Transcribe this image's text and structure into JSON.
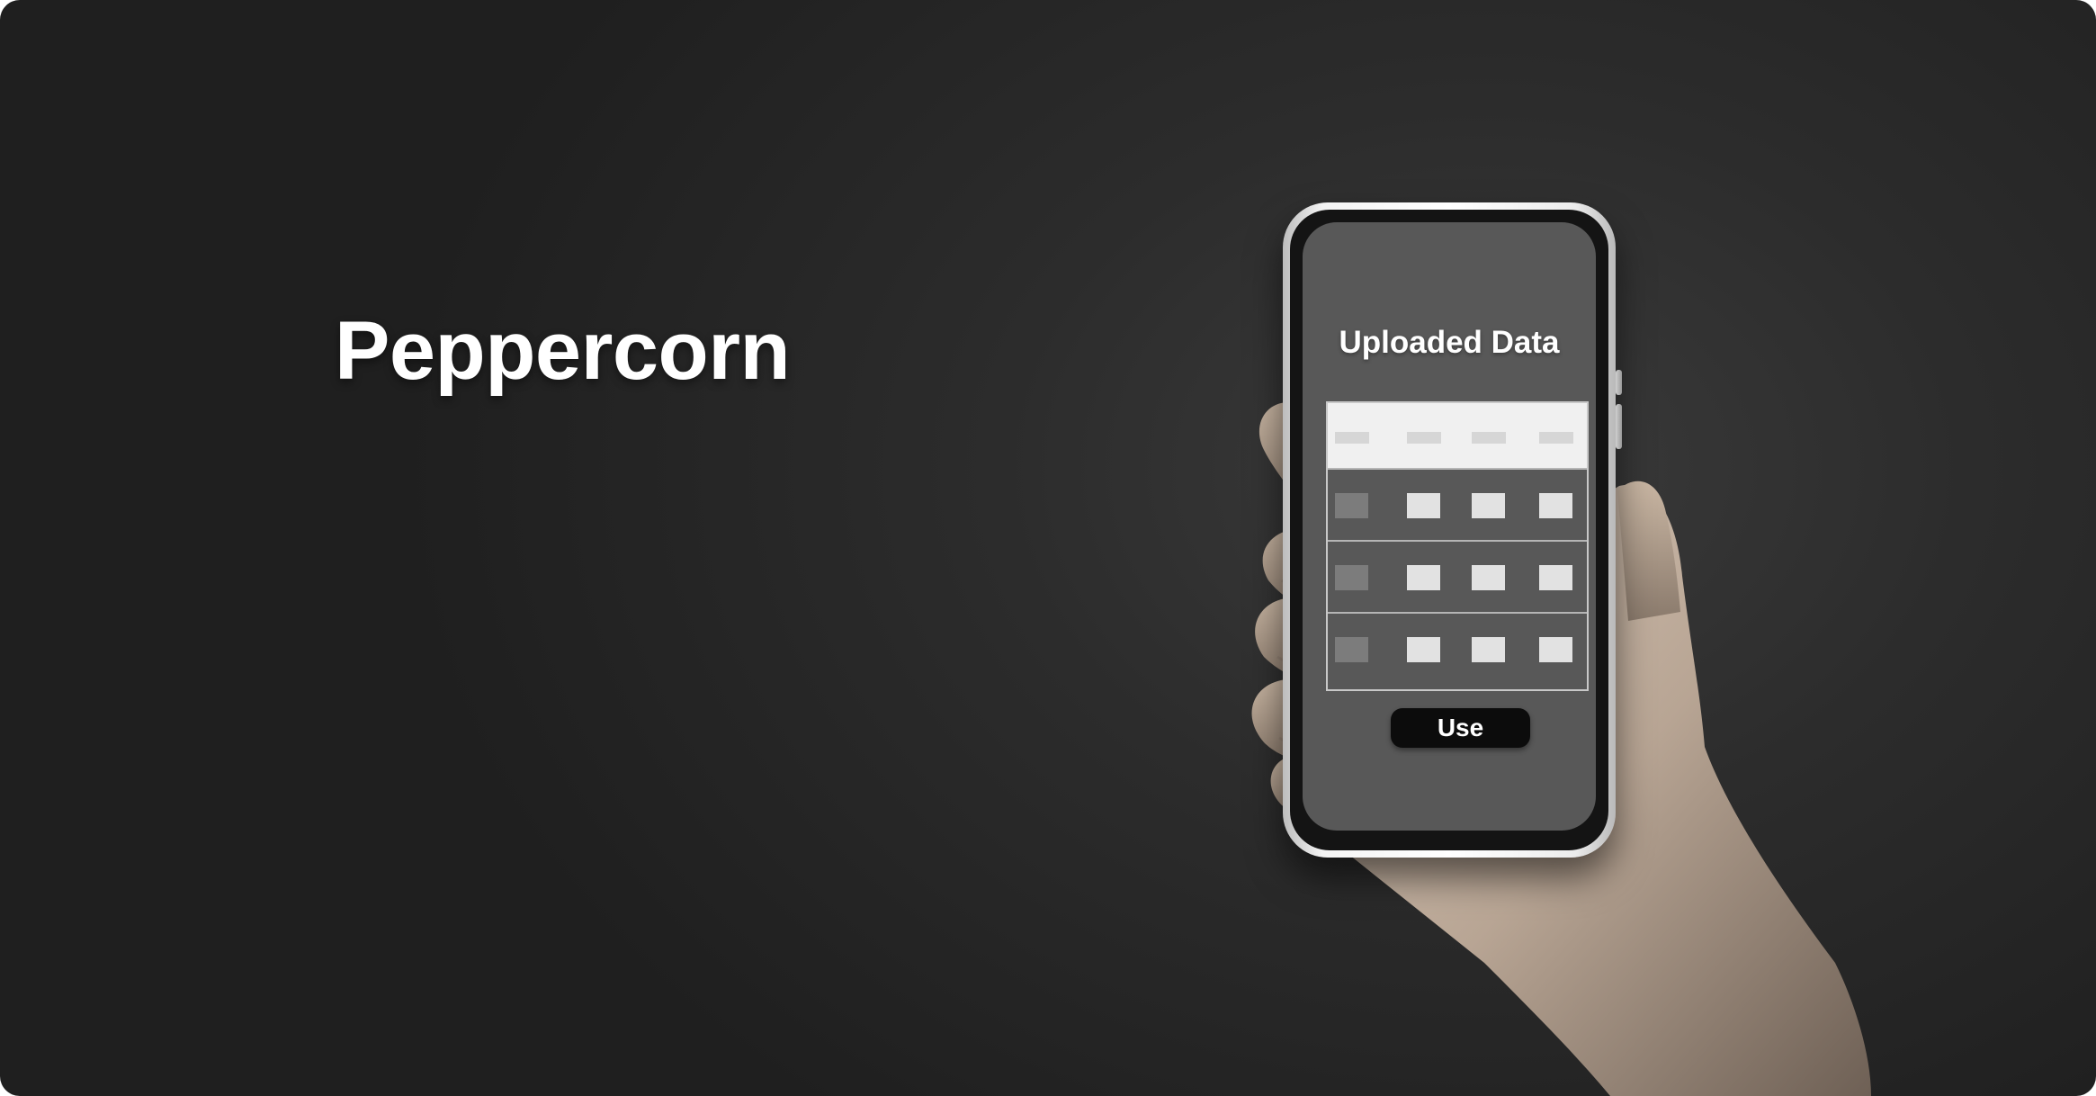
{
  "brand": {
    "title": "Peppercorn"
  },
  "phone_screen": {
    "title": "Uploaded Data",
    "use_button_label": "Use",
    "table": {
      "header_cells": 4,
      "rows": 3,
      "columns": 4
    }
  },
  "colors": {
    "background": "#2a2a2a",
    "screen": "#585858",
    "table_header": "#f0f0f0",
    "button": "#0c0c0c",
    "text": "#ffffff"
  }
}
